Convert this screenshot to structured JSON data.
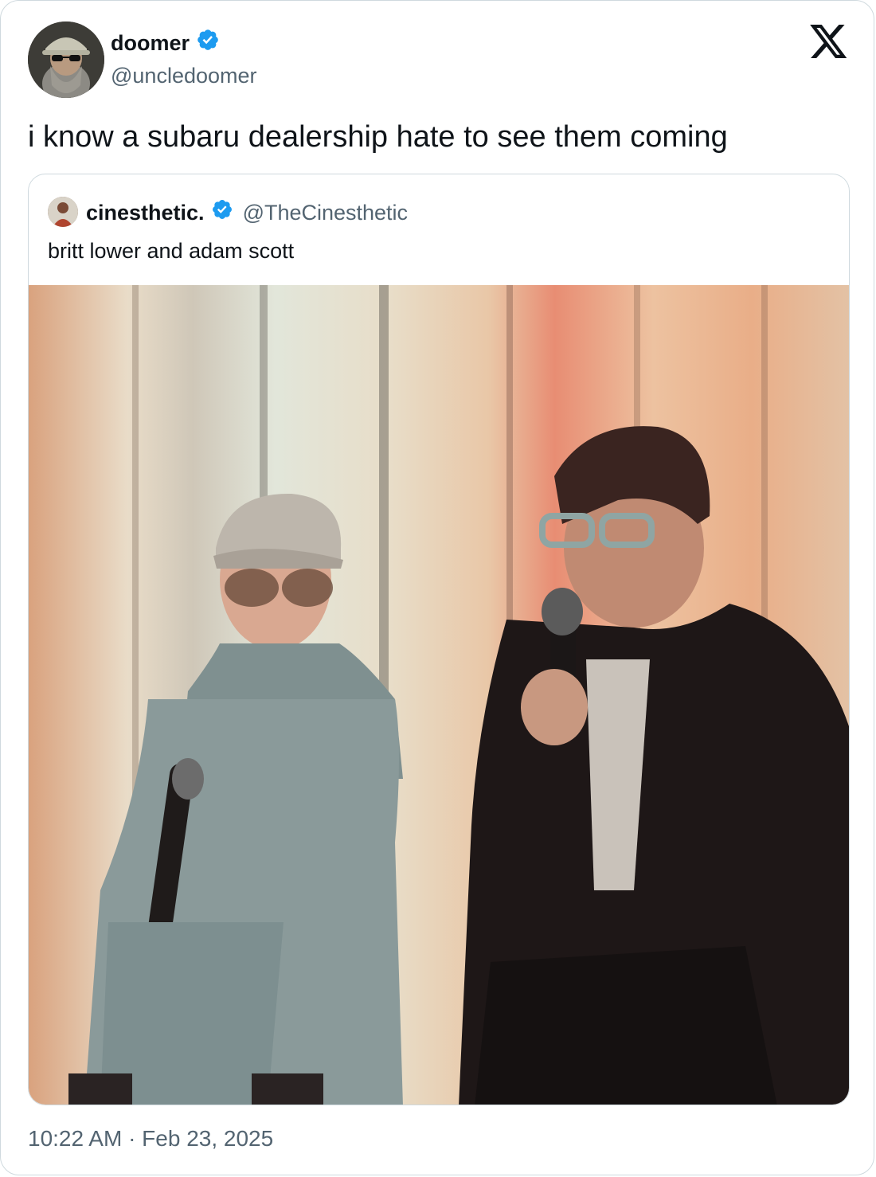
{
  "tweet": {
    "author": {
      "display_name": "doomer",
      "handle": "@uncledoomer",
      "verified": true,
      "avatar_icon": "bearded-man-avatar"
    },
    "text": "i know a subaru dealership hate to see them coming",
    "timestamp": "10:22 AM · Feb 23, 2025",
    "platform_logo": "x-logo",
    "quoted": {
      "display_name": "cinesthetic.",
      "handle": "@TheCinesthetic",
      "verified": true,
      "avatar_icon": "person-avatar",
      "text": "britt lower and adam scott",
      "media": {
        "description_icon": "photo-two-people-seated-with-microphones"
      }
    }
  },
  "colors": {
    "verified_blue": "#1d9bf0",
    "secondary_text": "#536471",
    "border": "#cfd9de",
    "text": "#0f1419"
  }
}
